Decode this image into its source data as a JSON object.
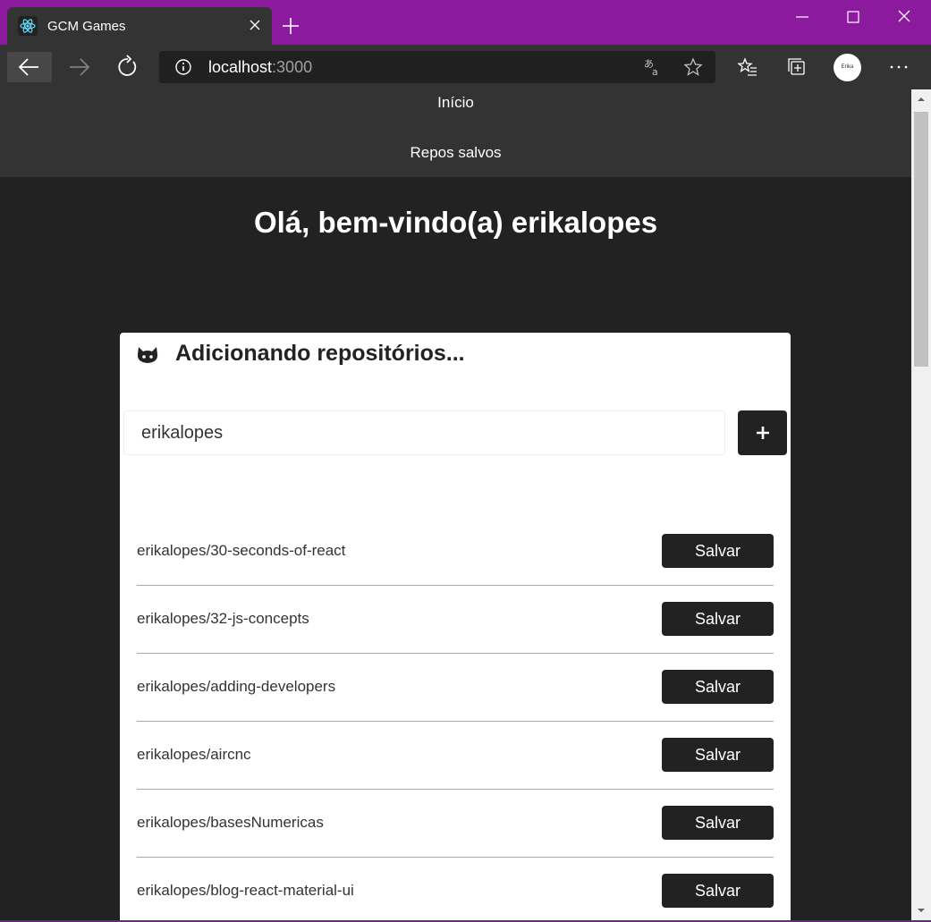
{
  "browser": {
    "tab_title": "GCM Games",
    "url_host": "localhost",
    "url_port": ":3000",
    "avatar_text": "Erika"
  },
  "nav": {
    "home": "Início",
    "saved": "Repos salvos"
  },
  "welcome": "Olá, bem-vindo(a) erikalopes",
  "card": {
    "title": "Adicionando repositórios...",
    "input_value": "erikalopes",
    "add_label": "+"
  },
  "repos": [
    {
      "name": "erikalopes/30-seconds-of-react",
      "button": "Salvar"
    },
    {
      "name": "erikalopes/32-js-concepts",
      "button": "Salvar"
    },
    {
      "name": "erikalopes/adding-developers",
      "button": "Salvar"
    },
    {
      "name": "erikalopes/aircnc",
      "button": "Salvar"
    },
    {
      "name": "erikalopes/basesNumericas",
      "button": "Salvar"
    },
    {
      "name": "erikalopes/blog-react-material-ui",
      "button": "Salvar"
    }
  ],
  "colors": {
    "titlebar": "#8b1a9e",
    "page_bg": "#222222",
    "nav_bg": "#333333",
    "button_bg": "#222222"
  }
}
